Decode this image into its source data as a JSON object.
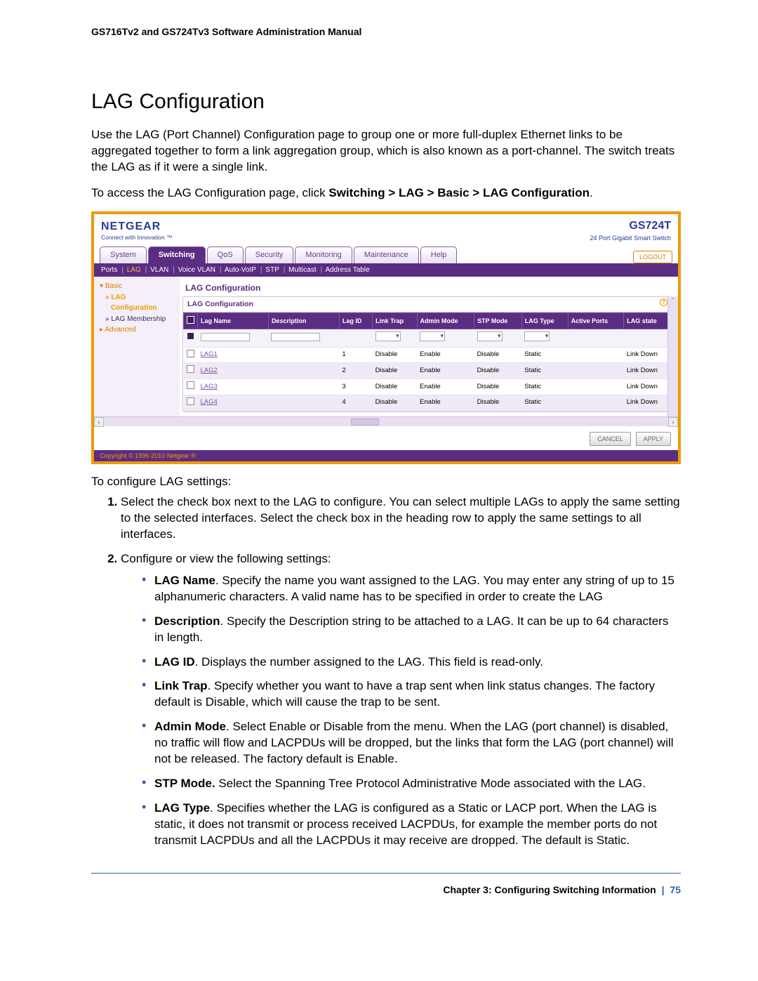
{
  "doc": {
    "header": "GS716Tv2 and GS724Tv3 Software Administration Manual",
    "title": "LAG Configuration",
    "intro1": "Use the LAG (Port Channel) Configuration page to group one or more full-duplex Ethernet links to be aggregated together to form a link aggregation group, which is also known as a port-channel. The switch treats the LAG as if it were a single link.",
    "intro2_prefix": "To access the LAG Configuration page, click ",
    "intro2_bold": "Switching > LAG > Basic > LAG Configuration",
    "intro2_suffix": ".",
    "post_lead": "To configure LAG settings:",
    "steps": {
      "s1": "Select the check box next to the LAG to configure. You can select multiple LAGs to apply the same setting to the selected interfaces. Select the check box in the heading row to apply the same settings to all interfaces.",
      "s2": "Configure or view the following settings:"
    },
    "bullets": {
      "b1_label": "LAG Name",
      "b1_text": ". Specify the name you want assigned to the LAG. You may enter any string of up to 15 alphanumeric characters. A valid name has to be specified in order to create the LAG",
      "b2_label": "Description",
      "b2_text": ". Specify the Description string to be attached to a LAG. It can be up to 64 characters in length.",
      "b3_label": "LAG ID",
      "b3_text": ". Displays the number assigned to the LAG. This field is read-only.",
      "b4_label": "Link Trap",
      "b4_text": ". Specify whether you want to have a trap sent when link status changes. The factory default is Disable, which will cause the trap to be sent.",
      "b5_label": "Admin Mode",
      "b5_text": ". Select Enable or Disable from the menu. When the LAG (port channel) is disabled, no traffic will flow and LACPDUs will be dropped, but the links that form the LAG (port channel) will not be released. The factory default is Enable.",
      "b6_label": "STP Mode.",
      "b6_text": " Select the Spanning Tree Protocol Administrative Mode associated with the LAG.",
      "b7_label": "LAG Type",
      "b7_text": ". Specifies whether the LAG is configured as a Static or LACP port. When the LAG is static, it does not transmit or process received LACPDUs, for example the member ports do not transmit LACPDUs and all the LACPDUs it may receive are dropped. The default is Static."
    },
    "footer_chapter": "Chapter 3:  Configuring Switching Information",
    "footer_page": "75"
  },
  "ss": {
    "brand": "NETGEAR",
    "brand_tag": "Connect with Innovation ™",
    "model": "GS724T",
    "model_sub": "24 Port Gigabit Smart Switch",
    "logout": "LOGOUT",
    "tabs": [
      "System",
      "Switching",
      "QoS",
      "Security",
      "Monitoring",
      "Maintenance",
      "Help"
    ],
    "subtabs": {
      "items": [
        "Ports",
        "LAG",
        "VLAN",
        "Voice VLAN",
        "Auto-VoIP",
        "STP",
        "Multicast",
        "Address Table"
      ],
      "active": "LAG"
    },
    "sidebar": {
      "l1": "Basic",
      "l2a": "LAG",
      "l2b": "Configuration",
      "l2c": "LAG Membership",
      "l3": "Advanced"
    },
    "panel_title": "LAG Configuration",
    "inner_title": "LAG Configuration",
    "cols": [
      "",
      "Lag Name",
      "Description",
      "Lag ID",
      "Link Trap",
      "Admin Mode",
      "STP Mode",
      "LAG Type",
      "Active Ports",
      "LAG state"
    ],
    "rows": [
      {
        "name": "LAG1",
        "id": "1",
        "trap": "Disable",
        "admin": "Enable",
        "stp": "Disable",
        "type": "Static",
        "state": "Link Down"
      },
      {
        "name": "LAG2",
        "id": "2",
        "trap": "Disable",
        "admin": "Enable",
        "stp": "Disable",
        "type": "Static",
        "state": "Link Down"
      },
      {
        "name": "LAG3",
        "id": "3",
        "trap": "Disable",
        "admin": "Enable",
        "stp": "Disable",
        "type": "Static",
        "state": "Link Down"
      },
      {
        "name": "LAG4",
        "id": "4",
        "trap": "Disable",
        "admin": "Enable",
        "stp": "Disable",
        "type": "Static",
        "state": "Link Down"
      }
    ],
    "buttons": {
      "cancel": "CANCEL",
      "apply": "APPLY"
    },
    "copyright": "Copyright © 1996-2010 Netgear ®"
  }
}
